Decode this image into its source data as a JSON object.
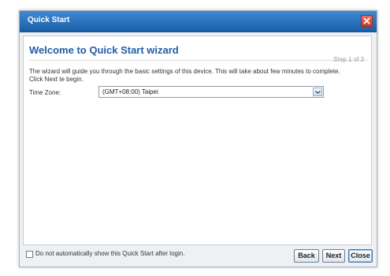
{
  "window": {
    "title": "Quick Start",
    "close_icon": "close-icon"
  },
  "wizard": {
    "heading": "Welcome to Quick Start wizard",
    "step": "Step 1 of 3",
    "description": "The wizard will guide you through the basic settings of this device. This will take about few minutes to complete. Click Next te begin."
  },
  "timezone": {
    "label": "Time Zone:",
    "selected": "(GMT+08:00) Taipei"
  },
  "footer": {
    "checkbox_label": "Do not automatically show this Quick Start after login.",
    "checkbox_checked": false,
    "back_label": "Back",
    "next_label": "Next",
    "close_label": "Close"
  },
  "colors": {
    "titlebar": "#2a74c0",
    "heading": "#1f5ea8",
    "close_button": "#d33c2a"
  }
}
